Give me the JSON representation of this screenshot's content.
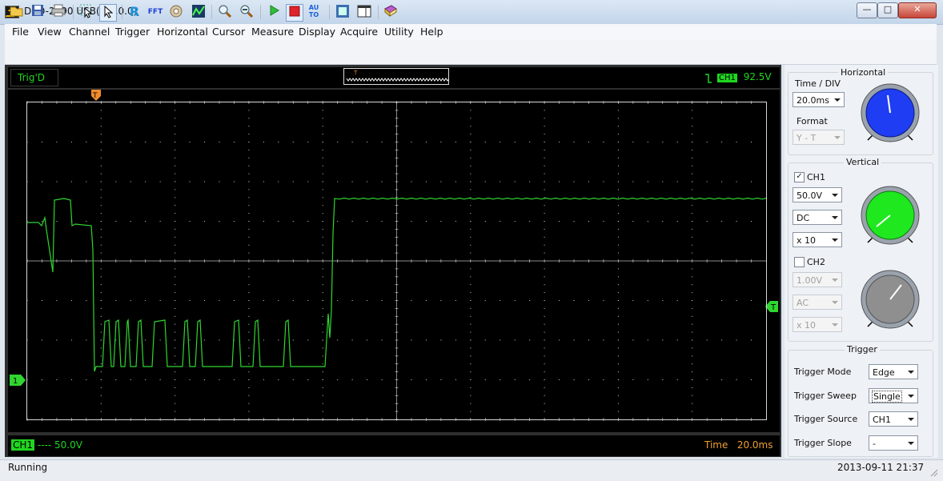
{
  "window": {
    "title": "DSO-2090 USB(7.0.0.0)"
  },
  "menu": [
    "File",
    "View",
    "Channel",
    "Trigger",
    "Horizontal",
    "Cursor",
    "Measure",
    "Display",
    "Acquire",
    "Utility",
    "Help"
  ],
  "toolbar": {
    "icons": [
      "open-icon",
      "save-icon",
      "print-icon",
      "select-icon",
      "pointer-icon",
      "reference-icon",
      "fft-icon",
      "math-icon",
      "persist-icon",
      "zoom-in-icon",
      "zoom-out-icon",
      "run-icon",
      "stop-icon",
      "auto-icon",
      "zoom-window-icon",
      "display-icon",
      "book-icon"
    ],
    "reference_glyph": "R",
    "fft_glyph": "FFT",
    "auto_glyph": "AUTO"
  },
  "scope": {
    "trig_status": "Trig'D",
    "trigger_info": {
      "channel": "CH1",
      "level": "92.5V"
    },
    "trigger_marker": "T",
    "channel_marker": "1",
    "trigger_level_marker": "T",
    "ch1_scale_label": "CH1",
    "ch1_scale_value": "50.0V",
    "time_label": "Time",
    "time_value": "20.0ms",
    "colors": {
      "trace": "#2fd62f",
      "grid": "#cfcfcf",
      "background": "#000000",
      "trigger": "#f08a2c"
    }
  },
  "panel": {
    "horizontal": {
      "title": "Horizontal",
      "time_div_label": "Time / DIV",
      "time_div_value": "20.0ms",
      "format_label": "Format",
      "format_value": "Y - T"
    },
    "vertical": {
      "title": "Vertical",
      "ch1_label": "CH1",
      "ch1_checked": true,
      "ch1_volts": "50.0V",
      "ch1_coupling": "DC",
      "ch1_probe": "x 10",
      "ch2_label": "CH2",
      "ch2_checked": false,
      "ch2_volts": "1.00V",
      "ch2_coupling": "AC",
      "ch2_probe": "x 10"
    },
    "trigger": {
      "title": "Trigger",
      "mode_label": "Trigger Mode",
      "mode_value": "Edge",
      "sweep_label": "Trigger Sweep",
      "sweep_value": "Single",
      "source_label": "Trigger Source",
      "source_value": "CH1",
      "slope_label": "Trigger Slope",
      "slope_value": "-"
    }
  },
  "status": {
    "text": "Running",
    "datetime": "2013-09-11   21:37"
  }
}
